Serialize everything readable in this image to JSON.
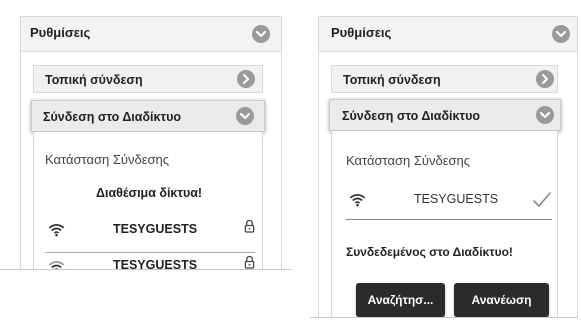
{
  "left": {
    "panel_title": "Ρυθμίσεις",
    "local_connection_label": "Τοπική σύνδεση",
    "internet_connection_label": "Σύνδεση στο Διαδίκτυο",
    "status_title": "Κατάσταση Σύνδεσης",
    "available_networks_text": "Διαθέσιμα δίκτυα!",
    "networks": [
      {
        "ssid": "TESYGUESTS",
        "icon": "wifi-icon",
        "secured": true
      },
      {
        "ssid": "TESYGUESTS",
        "icon": "wifi-icon",
        "secured": true
      }
    ]
  },
  "right": {
    "panel_title": "Ρυθμίσεις",
    "local_connection_label": "Τοπική σύνδεση",
    "internet_connection_label": "Σύνδεση στο Διαδίκτυο",
    "status_title": "Κατάσταση Σύνδεσης",
    "connected_network": {
      "ssid": "TESYGUESTS",
      "icon": "wifi-icon",
      "status_icon": "checkmark-icon"
    },
    "connected_text": "Συνδεδεμένος στο Διαδίκτυο!",
    "search_button_label": "Αναζήτησ...",
    "refresh_button_label": "Ανανέωση"
  },
  "colors": {
    "header_bg": "#f3f3f3",
    "icon_gray": "#9a9a9a",
    "button_bg": "#2b2b2b",
    "text_dark": "#222222"
  }
}
